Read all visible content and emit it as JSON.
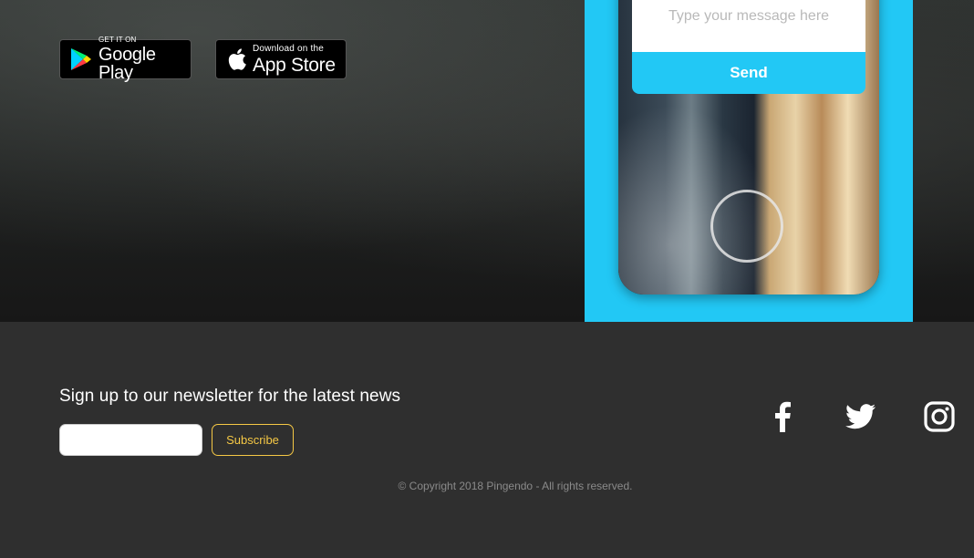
{
  "store_badges": {
    "google": {
      "small": "GET IT ON",
      "big": "Google Play"
    },
    "apple": {
      "small": "Download on the",
      "big": "App Store"
    }
  },
  "phone": {
    "message_placeholder": "Type your message here",
    "send_label": "Send"
  },
  "footer": {
    "newsletter_title": "Sign up to our newsletter for the latest news",
    "subscribe_label": "Subscribe",
    "email_value": "",
    "social": [
      "facebook-icon",
      "twitter-icon",
      "instagram-icon"
    ],
    "copyright": "© Copyright 2018 Pingendo - All rights reserved."
  },
  "colors": {
    "accent_cyan": "#22c8f5",
    "accent_yellow": "#f5c845",
    "footer_bg": "#2f2f2f"
  }
}
